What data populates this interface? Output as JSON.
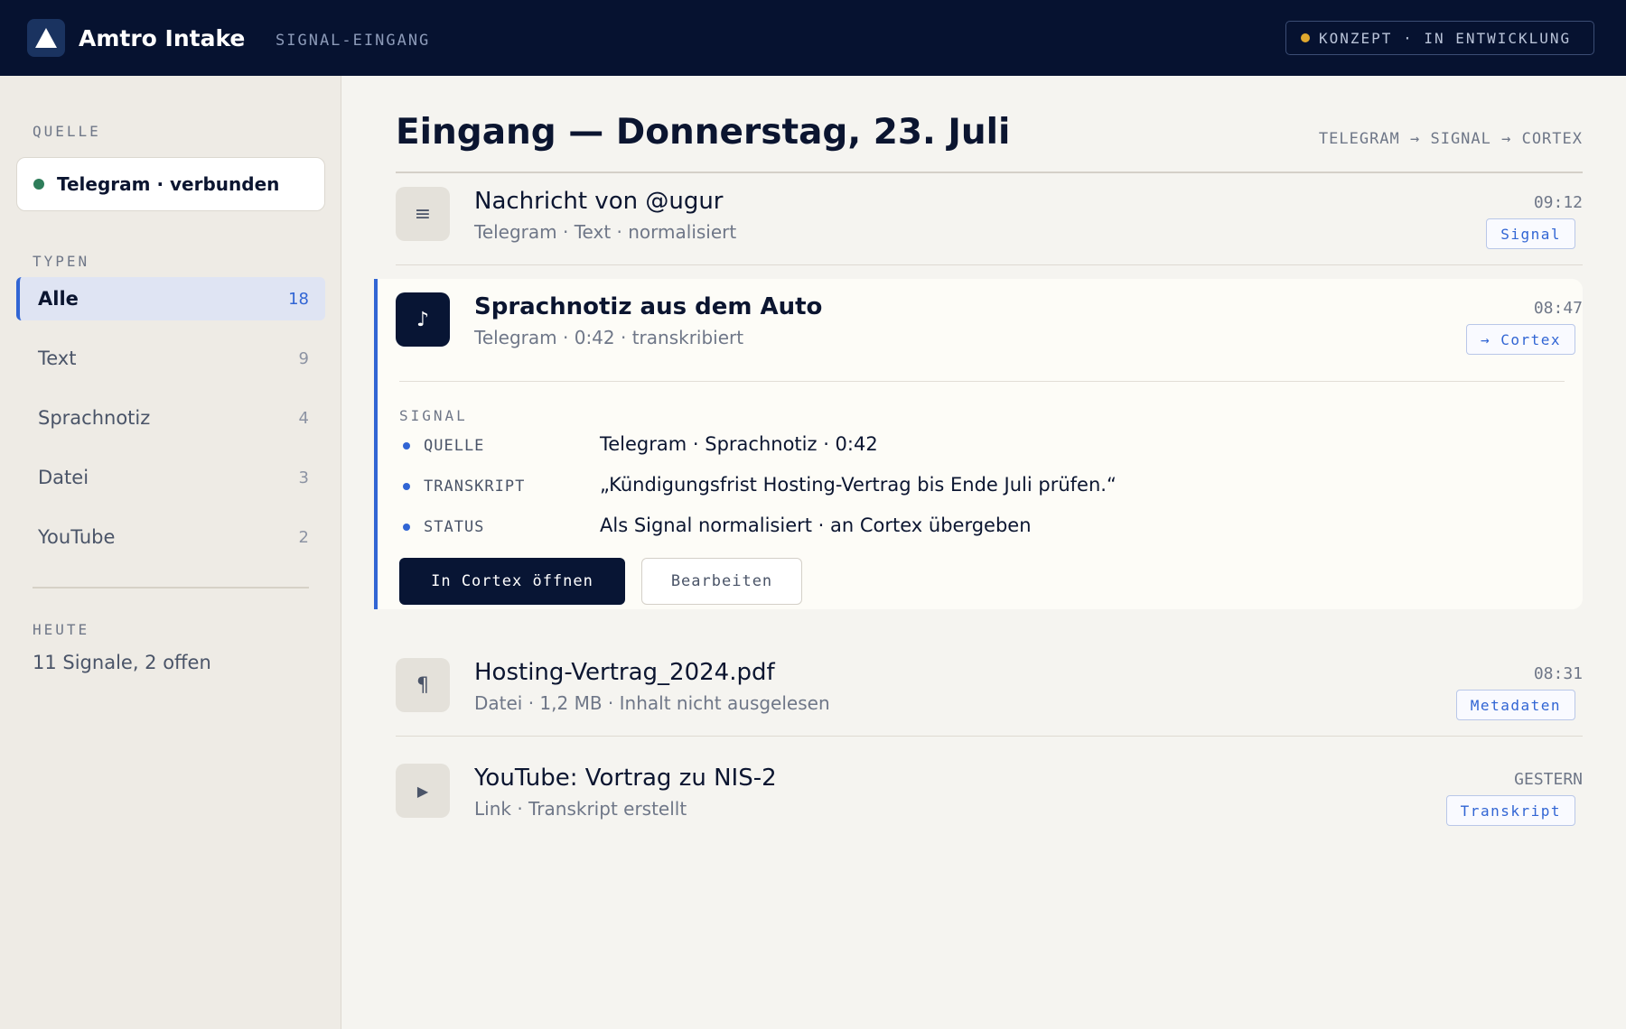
{
  "header": {
    "app_name": "Amtro Intake",
    "subtitle": "SIGNAL-EINGANG",
    "status": "KONZEPT · IN ENTWICKLUNG",
    "status_color": "#e0a82e"
  },
  "sidebar": {
    "source_label": "QUELLE",
    "source_status": "Telegram · verbunden",
    "types_label": "TYPEN",
    "types": [
      {
        "label": "Alle",
        "count": "18",
        "active": true
      },
      {
        "label": "Text",
        "count": "9"
      },
      {
        "label": "Sprachnotiz",
        "count": "4"
      },
      {
        "label": "Datei",
        "count": "3"
      },
      {
        "label": "YouTube",
        "count": "2"
      }
    ],
    "today_label": "HEUTE",
    "today_summary": "11 Signale, 2 offen"
  },
  "main": {
    "title": "Eingang — Donnerstag, 23. Juli",
    "pipeline": "TELEGRAM → SIGNAL → CORTEX",
    "items": [
      {
        "icon": "text-icon",
        "glyph": "≡",
        "title": "Nachricht von @ugur",
        "meta": "Telegram · Text · normalisiert",
        "time": "09:12",
        "tag": "Signal"
      },
      {
        "icon": "music-note-icon",
        "glyph": "♪",
        "title": "Sprachnotiz aus dem Auto",
        "meta": "Telegram · 0:42 · transkribiert",
        "time": "08:47",
        "tag": "→ Cortex"
      },
      {
        "icon": "pilcrow-icon",
        "glyph": "¶",
        "title": "Hosting-Vertrag_2024.pdf",
        "meta": "Datei · 1,2 MB · Inhalt nicht ausgelesen",
        "time": "08:31",
        "tag": "Metadaten"
      },
      {
        "icon": "play-icon",
        "glyph": "▶",
        "title": "YouTube: Vortrag zu NIS-2",
        "meta": "Link · Transkript erstellt",
        "time": "GESTERN",
        "tag": "Transkript"
      }
    ],
    "detail": {
      "section_label": "SIGNAL",
      "rows": [
        {
          "key": "QUELLE",
          "value": "Telegram · Sprachnotiz · 0:42"
        },
        {
          "key": "TRANSKRIPT",
          "value": "„Kündigungsfrist Hosting-Vertrag bis Ende Juli prüfen.“"
        },
        {
          "key": "STATUS",
          "value": "Als Signal normalisiert · an Cortex übergeben"
        }
      ],
      "primary_button": "In Cortex öffnen",
      "secondary_button": "Bearbeiten"
    }
  },
  "colors": {
    "accent": "#3165d4",
    "navy": "#061230",
    "connected": "#2e7d5a"
  }
}
